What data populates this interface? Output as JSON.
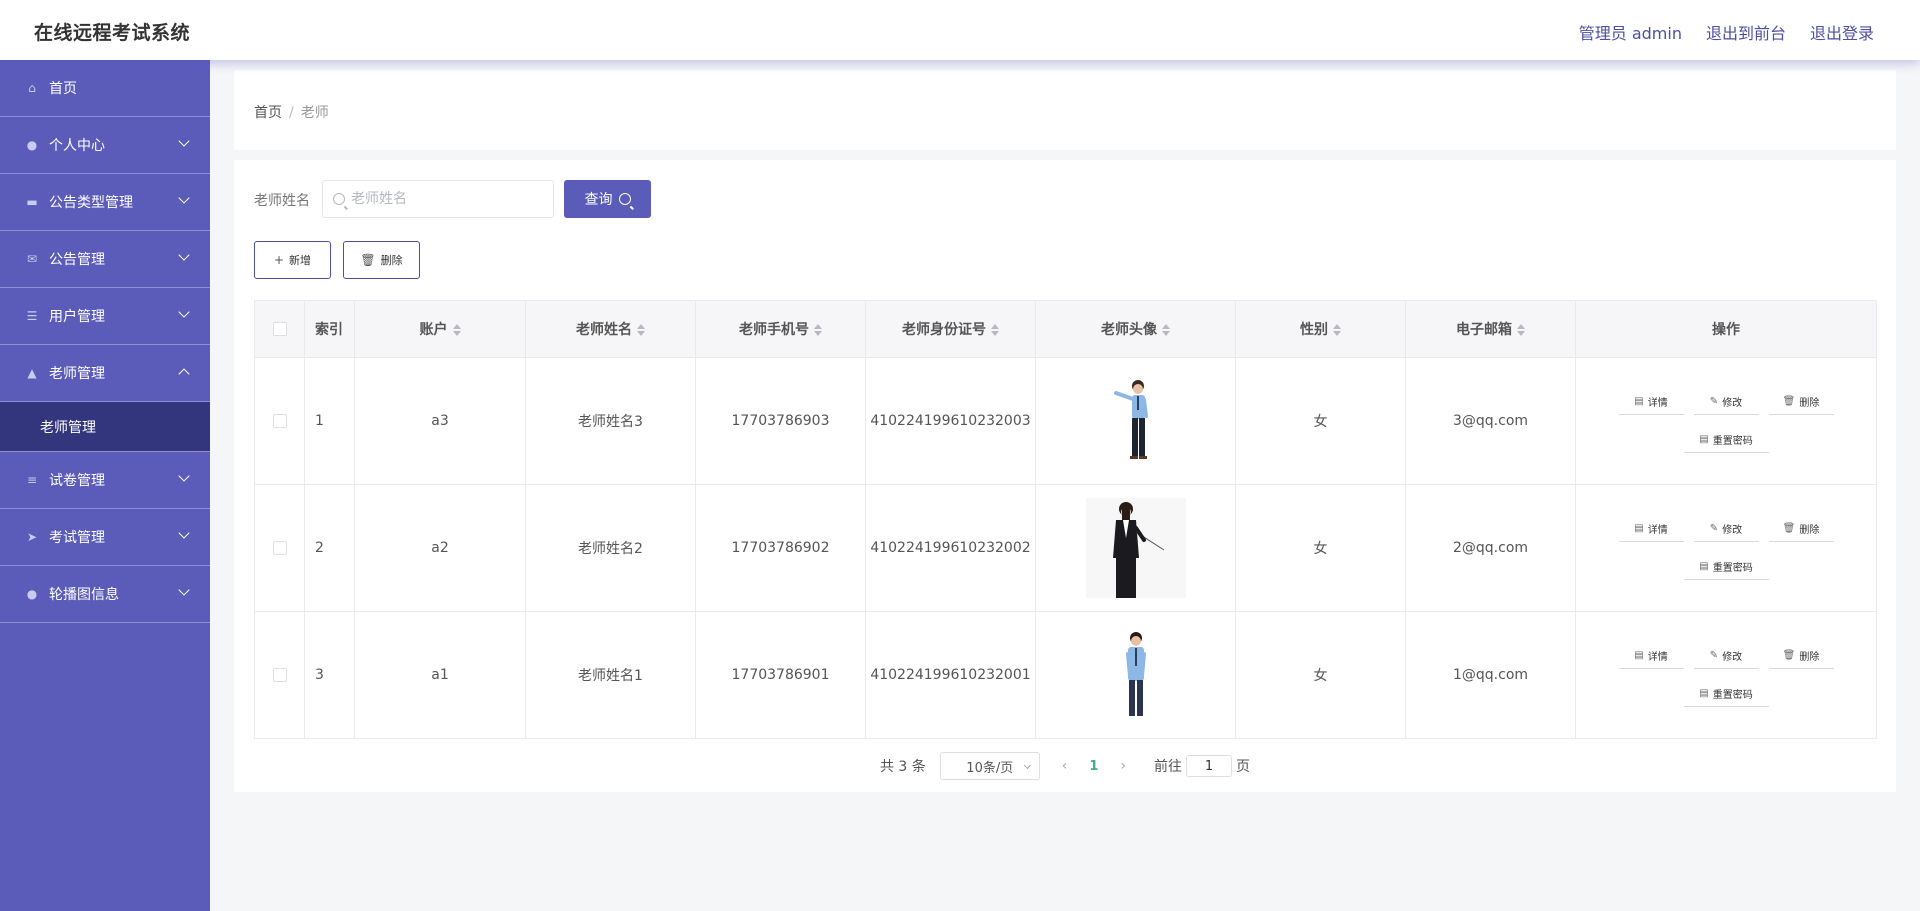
{
  "header": {
    "title": "在线远程考试系统",
    "admin_label": "管理员 admin",
    "back_to_front": "退出到前台",
    "logout": "退出登录"
  },
  "sidebar": {
    "items": [
      {
        "label": "首页",
        "icon": "home-icon"
      },
      {
        "label": "个人中心",
        "icon": "user-icon"
      },
      {
        "label": "公告类型管理",
        "icon": "tag-icon"
      },
      {
        "label": "公告管理",
        "icon": "mail-icon"
      },
      {
        "label": "用户管理",
        "icon": "sliders-icon"
      },
      {
        "label": "老师管理",
        "icon": "teacher-icon",
        "expanded": true,
        "subitems": [
          {
            "label": "老师管理",
            "active": true
          }
        ]
      },
      {
        "label": "试卷管理",
        "icon": "list-icon"
      },
      {
        "label": "考试管理",
        "icon": "send-icon"
      },
      {
        "label": "轮播图信息",
        "icon": "user-icon"
      }
    ]
  },
  "breadcrumb": {
    "home": "首页",
    "sep": "/",
    "current": "老师"
  },
  "search": {
    "label": "老师姓名",
    "placeholder": "老师姓名",
    "value": "",
    "button": "查询"
  },
  "actions": {
    "add": "新增",
    "delete": "删除"
  },
  "table": {
    "headers": {
      "index": "索引",
      "account": "账户",
      "name": "老师姓名",
      "phone": "老师手机号",
      "idcard": "老师身份证号",
      "avatar": "老师头像",
      "gender": "性别",
      "email": "电子邮箱",
      "ops": "操作"
    },
    "rows": [
      {
        "index": "1",
        "account": "a3",
        "name": "老师姓名3",
        "phone": "17703786903",
        "idcard": "410224199610232003",
        "gender": "女",
        "email": "3@qq.com"
      },
      {
        "index": "2",
        "account": "a2",
        "name": "老师姓名2",
        "phone": "17703786902",
        "idcard": "410224199610232002",
        "gender": "女",
        "email": "2@qq.com"
      },
      {
        "index": "3",
        "account": "a1",
        "name": "老师姓名1",
        "phone": "17703786901",
        "idcard": "410224199610232001",
        "gender": "女",
        "email": "1@qq.com"
      }
    ],
    "row_ops": {
      "detail": "详情",
      "edit": "修改",
      "delete": "删除",
      "reset": "重置密码"
    }
  },
  "pagination": {
    "total": "共 3 条",
    "page_size": "10条/页",
    "current_page": "1",
    "goto_label": "前往",
    "goto_value": "1",
    "page_suffix": "页"
  },
  "colors": {
    "primary": "#5b5cba",
    "sidebar_active": "#34367d",
    "header_link": "#4d4f9f",
    "page_active": "#3bb27a"
  }
}
